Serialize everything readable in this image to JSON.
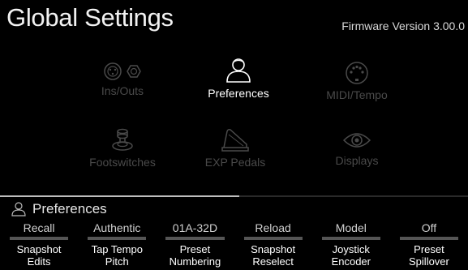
{
  "header": {
    "title": "Global Settings",
    "firmware": "Firmware Version 3.00.0"
  },
  "categories": [
    {
      "label": "Ins/Outs",
      "icon": "ins-outs-icon",
      "active": false
    },
    {
      "label": "Preferences",
      "icon": "person-icon",
      "active": true
    },
    {
      "label": "MIDI/Tempo",
      "icon": "midi-icon",
      "active": false
    },
    {
      "label": "Footswitches",
      "icon": "footswitch-icon",
      "active": false
    },
    {
      "label": "EXP Pedals",
      "icon": "exp-pedal-icon",
      "active": false
    },
    {
      "label": "Displays",
      "icon": "eye-icon",
      "active": false
    }
  ],
  "section": {
    "title": "Preferences",
    "icon": "person-icon"
  },
  "params": [
    {
      "value": "Recall",
      "name_line1": "Snapshot",
      "name_line2": "Edits"
    },
    {
      "value": "Authentic",
      "name_line1": "Tap Tempo",
      "name_line2": "Pitch"
    },
    {
      "value": "01A-32D",
      "name_line1": "Preset",
      "name_line2": "Numbering"
    },
    {
      "value": "Reload",
      "name_line1": "Snapshot",
      "name_line2": "Reselect"
    },
    {
      "value": "Model",
      "name_line1": "Joystick",
      "name_line2": "Encoder"
    },
    {
      "value": "Off",
      "name_line1": "Preset",
      "name_line2": "Spillover"
    }
  ],
  "colors": {
    "background": "#000000",
    "active": "#ffffff",
    "inactive": "#4a4a4a"
  }
}
